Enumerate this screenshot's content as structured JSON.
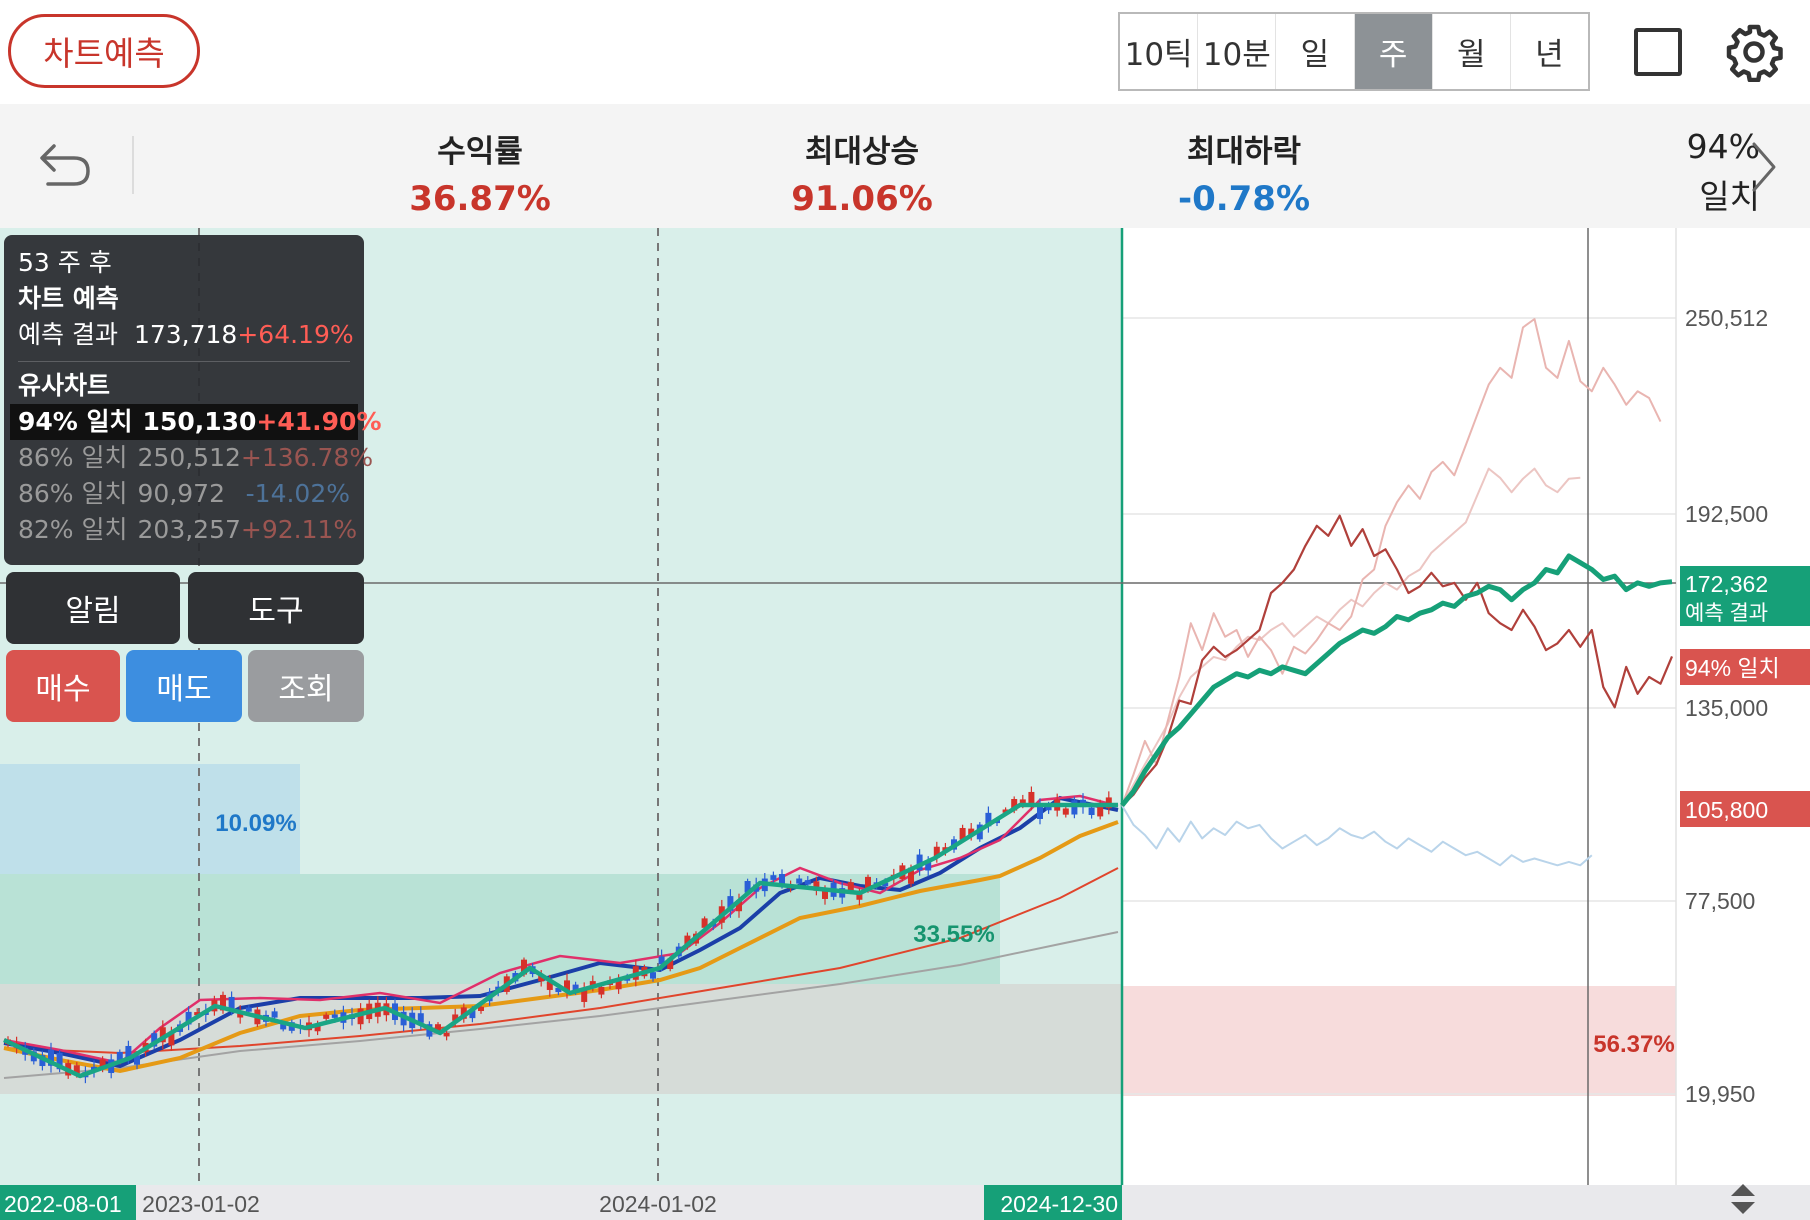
{
  "header": {
    "chart_predict_label": "차트예측",
    "periods": [
      {
        "label": "10틱",
        "active": false
      },
      {
        "label": "10분",
        "active": false
      },
      {
        "label": "일",
        "active": false
      },
      {
        "label": "주",
        "active": true
      },
      {
        "label": "월",
        "active": false
      },
      {
        "label": "년",
        "active": false
      }
    ]
  },
  "stats": {
    "return_label": "수익률",
    "return_value": "36.87%",
    "max_rise_label": "최대상승",
    "max_rise_value": "91.06%",
    "max_fall_label": "최대하락",
    "max_fall_value": "-0.78%",
    "match_percent": "94%",
    "match_word": "일치"
  },
  "info_panel": {
    "weeks_after": "53 주 후",
    "prediction_title": "차트 예측",
    "prediction_result_label": "예측 결과",
    "prediction_result_price": "173,718",
    "prediction_result_change": "+64.19%",
    "similar_title": "유사차트",
    "rows": [
      {
        "match": "94% 일치",
        "price": "150,130",
        "change": "+41.90%"
      },
      {
        "match": "86% 일치",
        "price": "250,512",
        "change": "+136.78%"
      },
      {
        "match": "86% 일치",
        "price": "90,972",
        "change": "-14.02%"
      },
      {
        "match": "82% 일치",
        "price": "203,257",
        "change": "+92.11%"
      }
    ]
  },
  "buttons": {
    "alarm": "알림",
    "tool": "도구",
    "buy": "매수",
    "sell": "매도",
    "inquiry": "조회"
  },
  "colors": {
    "red": "#c8352b",
    "blue": "#1f78c8",
    "green": "#16a078",
    "buy": "#d9544f",
    "sell": "#3d8ee0"
  },
  "chart_data": {
    "type": "line",
    "x_labels": [
      "2022-08-01",
      "2023-01-02",
      "2024-01-02",
      "2024-12-30"
    ],
    "y_ticks": [
      "250,512",
      "192,500",
      "135,000",
      "77,500",
      "19,950"
    ],
    "price_tags": [
      {
        "label": "172,362",
        "color": "#16a078"
      },
      {
        "label": "예측 결과",
        "color": "#16a078"
      },
      {
        "label": "94% 일치",
        "color": "#d9544f"
      },
      {
        "label": "105,800",
        "color": "#d9544f"
      }
    ],
    "zone_labels": [
      "10.09%",
      "33.55%",
      "56.37%"
    ],
    "series": [
      {
        "name": "예측 결과",
        "color": "#16a078",
        "values": [
          105800,
          110000,
          116000,
          121000,
          126000,
          129000,
          133000,
          137000,
          141000,
          143000,
          145000,
          144000,
          146000,
          145000,
          147000,
          146000,
          145000,
          148000,
          151000,
          154000,
          156000,
          158000,
          157000,
          159000,
          162000,
          161000,
          163000,
          164000,
          166000,
          165000,
          168000,
          169000,
          171000,
          170000,
          167000,
          170000,
          172000,
          176000,
          175000,
          180000,
          178000,
          176000,
          173000,
          174000,
          170000,
          172000,
          171000,
          172000,
          172362
        ]
      },
      {
        "name": "94% 일치",
        "color": "#b0403b",
        "values": [
          105800,
          109000,
          114000,
          118000,
          126000,
          137000,
          136000,
          149000,
          153000,
          150000,
          152000,
          155000,
          158000,
          169000,
          172000,
          176000,
          183000,
          189000,
          186000,
          192000,
          183000,
          188000,
          180000,
          182000,
          176000,
          169000,
          171000,
          175000,
          171000,
          172000,
          167000,
          172000,
          163000,
          160000,
          158000,
          164000,
          159000,
          152000,
          154000,
          158000,
          153000,
          158000,
          141000,
          135000,
          147000,
          139000,
          144000,
          142000,
          150130
        ]
      },
      {
        "name": "86% 일치",
        "color": "#e9b5b1",
        "values": [
          105800,
          115000,
          125000,
          118000,
          131000,
          144000,
          160000,
          152000,
          163000,
          156000,
          158000,
          150000,
          156000,
          152000,
          145000,
          153000,
          151000,
          155000,
          160000,
          158000,
          162000,
          173000,
          176000,
          189000,
          196000,
          201000,
          197000,
          205000,
          208000,
          204000,
          213000,
          222000,
          231000,
          236000,
          233000,
          248000,
          250512,
          236000,
          233000,
          244000,
          232000,
          229000,
          236000,
          231000,
          225000,
          229000,
          227000,
          220000
        ]
      },
      {
        "name": "86% 일치",
        "color": "#b9d4ea",
        "values": [
          105800,
          100000,
          97000,
          93000,
          99000,
          95000,
          101000,
          96000,
          99000,
          97000,
          101000,
          99000,
          100000,
          96000,
          93000,
          95000,
          97000,
          94000,
          96000,
          99000,
          97000,
          96000,
          98000,
          95000,
          93000,
          96000,
          94000,
          92000,
          95000,
          93000,
          91000,
          92000,
          90000,
          88000,
          91000,
          89000,
          90000,
          89000,
          88000,
          89000,
          88000,
          90972
        ]
      },
      {
        "name": "82% 일치",
        "color": "#ecc6c3",
        "values": [
          105800,
          112000,
          118000,
          124000,
          130000,
          138000,
          144000,
          147000,
          150000,
          149000,
          153000,
          156000,
          155000,
          158000,
          160000,
          156000,
          159000,
          162000,
          160000,
          164000,
          167000,
          165000,
          169000,
          172000,
          170000,
          174000,
          176000,
          181000,
          184000,
          187000,
          190000,
          198000,
          206000,
          203257,
          199000,
          203000,
          206000,
          201000,
          199000,
          203000,
          203257
        ]
      }
    ]
  }
}
